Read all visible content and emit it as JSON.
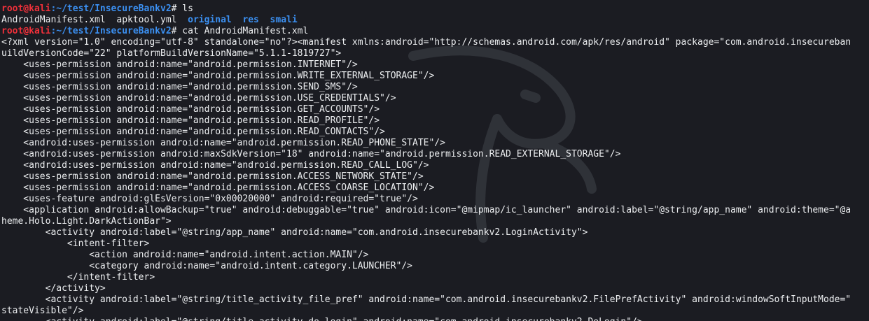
{
  "colors": {
    "background": "#1b1c22",
    "text": "#eceef0",
    "prompt_user": "#f0303a",
    "prompt_path": "#3b8ff0",
    "directory": "#3b8ff0"
  },
  "icons": {
    "watermark": "kali-dragon-icon"
  },
  "prompt": {
    "user_host": "root@kali",
    "path": ":~/test/InsecureBankv2",
    "symbol": "# "
  },
  "commands": [
    "ls",
    "cat AndroidManifest.xml"
  ],
  "ls_output": {
    "files": [
      "AndroidManifest.xml",
      "apktool.yml"
    ],
    "directories": [
      "original",
      "res",
      "smali"
    ]
  },
  "manifest_lines": [
    "<?xml version=\"1.0\" encoding=\"utf-8\" standalone=\"no\"?><manifest xmlns:android=\"http://schemas.android.com/apk/res/android\" package=\"com.android.insecureban",
    "uildVersionCode=\"22\" platformBuildVersionName=\"5.1.1-1819727\">",
    "    <uses-permission android:name=\"android.permission.INTERNET\"/>",
    "    <uses-permission android:name=\"android.permission.WRITE_EXTERNAL_STORAGE\"/>",
    "    <uses-permission android:name=\"android.permission.SEND_SMS\"/>",
    "    <uses-permission android:name=\"android.permission.USE_CREDENTIALS\"/>",
    "    <uses-permission android:name=\"android.permission.GET_ACCOUNTS\"/>",
    "    <uses-permission android:name=\"android.permission.READ_PROFILE\"/>",
    "    <uses-permission android:name=\"android.permission.READ_CONTACTS\"/>",
    "    <android:uses-permission android:name=\"android.permission.READ_PHONE_STATE\"/>",
    "    <android:uses-permission android:maxSdkVersion=\"18\" android:name=\"android.permission.READ_EXTERNAL_STORAGE\"/>",
    "    <android:uses-permission android:name=\"android.permission.READ_CALL_LOG\"/>",
    "    <uses-permission android:name=\"android.permission.ACCESS_NETWORK_STATE\"/>",
    "    <uses-permission android:name=\"android.permission.ACCESS_COARSE_LOCATION\"/>",
    "    <uses-feature android:glEsVersion=\"0x00020000\" android:required=\"true\"/>",
    "    <application android:allowBackup=\"true\" android:debuggable=\"true\" android:icon=\"@mipmap/ic_launcher\" android:label=\"@string/app_name\" android:theme=\"@a",
    "heme.Holo.Light.DarkActionBar\">",
    "        <activity android:label=\"@string/app_name\" android:name=\"com.android.insecurebankv2.LoginActivity\">",
    "            <intent-filter>",
    "                <action android:name=\"android.intent.action.MAIN\"/>",
    "                <category android:name=\"android.intent.category.LAUNCHER\"/>",
    "            </intent-filter>",
    "        </activity>",
    "        <activity android:label=\"@string/title_activity_file_pref\" android:name=\"com.android.insecurebankv2.FilePrefActivity\" android:windowSoftInputMode=\"",
    "stateVisible\"/>",
    "        <activity android:label=\"@string/title_activity_do_login\" android:name=\"com.android.insecurebankv2.DoLogin\"/>"
  ]
}
